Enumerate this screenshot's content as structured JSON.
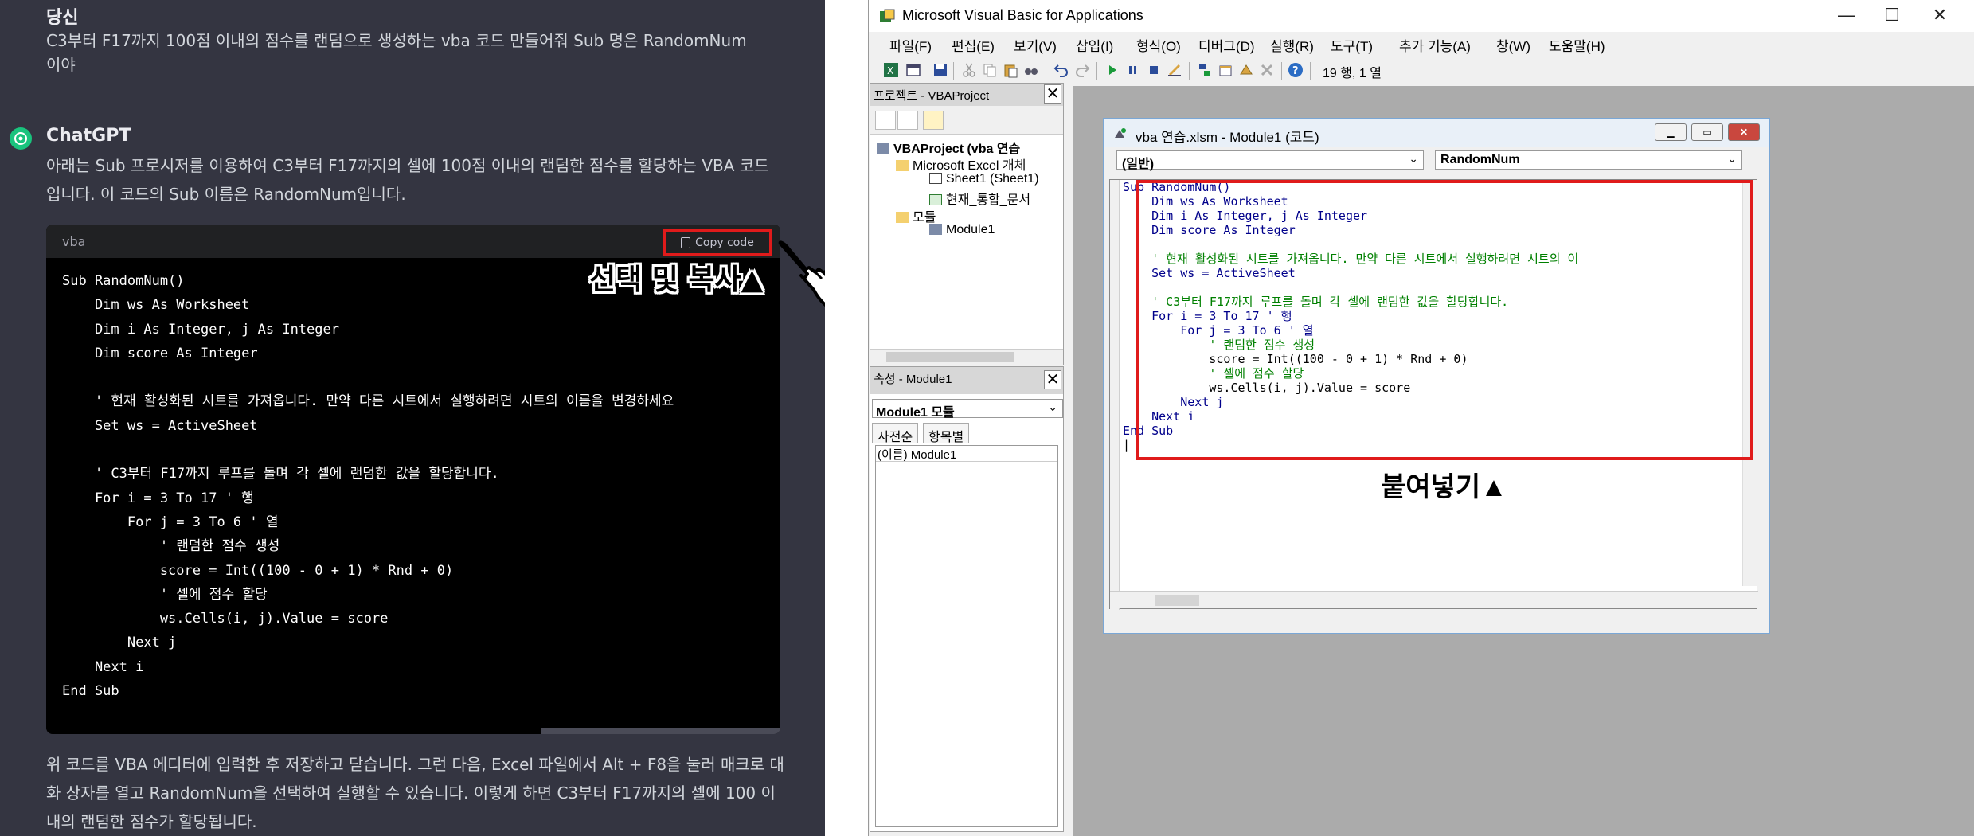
{
  "chat": {
    "user_name": "당신",
    "user_message": "C3부터 F17까지 100점 이내의 점수를 랜덤으로 생성하는 vba 코드 만들어줘 Sub 명은 RandomNum 이야",
    "bot_name": "ChatGPT",
    "bot_message": "아래는 Sub 프로시저를 이용하여 C3부터 F17까지의 셀에 100점 이내의 랜덤한 점수를 할당하는 VBA 코드입니다. 이 코드의 Sub 이름은 RandomNum입니다.",
    "code_lang": "vba",
    "copy_label": "Copy code",
    "code": "Sub RandomNum()\n    Dim ws As Worksheet\n    Dim i As Integer, j As Integer\n    Dim score As Integer\n\n    ' 현재 활성화된 시트를 가져옵니다. 만약 다른 시트에서 실행하려면 시트의 이름을 변경하세요\n    Set ws = ActiveSheet\n\n    ' C3부터 F17까지 루프를 돌며 각 셀에 랜덤한 값을 할당합니다.\n    For i = 3 To 17 ' 행\n        For j = 3 To 6 ' 열\n            ' 랜덤한 점수 생성\n            score = Int((100 - 0 + 1) * Rnd + 0)\n            ' 셀에 점수 할당\n            ws.Cells(i, j).Value = score\n        Next j\n    Next i\nEnd Sub",
    "followup": "위 코드를 VBA 에디터에 입력한 후 저장하고 닫습니다. 그런 다음, Excel 파일에서 Alt + F8을 눌러 매크로 대화 상자를 열고 RandomNum을 선택하여 실행할 수 있습니다. 이렇게 하면 C3부터 F17까지의 셀에 100 이내의 랜덤한 점수가 할당됩니다."
  },
  "annotations": {
    "copy": "선택 및 복사▲",
    "paste": "붙여넣기▲"
  },
  "vba": {
    "title": "Microsoft Visual Basic for Applications",
    "menu": [
      "파일(F)",
      "편집(E)",
      "보기(V)",
      "삽입(I)",
      "형식(O)",
      "디버그(D)",
      "실행(R)",
      "도구(T)",
      "추가 기능(A)",
      "창(W)",
      "도움말(H)"
    ],
    "cursor_pos": "19 행, 1 열",
    "project_title": "프로젝트 - VBAProject",
    "tree": {
      "root": "VBAProject (vba 연습",
      "excel_objects": "Microsoft Excel 개체",
      "sheet1": "Sheet1 (Sheet1)",
      "workbook": "현재_통합_문서",
      "modules": "모듈",
      "module1": "Module1"
    },
    "props_title": "속성 - Module1",
    "props_select": "Module1 모듈",
    "props_tab_alpha": "사전순",
    "props_tab_cat": "항목별",
    "props_row": "(이름) Module1",
    "code_window_title": "vba 연습.xlsm - Module1 (코드)",
    "combo_object": "(일반)",
    "combo_proc": "RandomNum",
    "code_lines": [
      {
        "t": "Sub RandomNum()",
        "c": "kw"
      },
      {
        "t": "    Dim ws As Worksheet",
        "c": "kw"
      },
      {
        "t": "    Dim i As Integer, j As Integer",
        "c": "kw"
      },
      {
        "t": "    Dim score As Integer",
        "c": "kw"
      },
      {
        "t": "",
        "c": ""
      },
      {
        "t": "    ' 현재 활성화된 시트를 가져옵니다. 만약 다른 시트에서 실행하려면 시트의 이",
        "c": "cm"
      },
      {
        "t": "    Set ws = ActiveSheet",
        "c": "kw"
      },
      {
        "t": "",
        "c": ""
      },
      {
        "t": "    ' C3부터 F17까지 루프를 돌며 각 셀에 랜덤한 값을 할당합니다.",
        "c": "cm"
      },
      {
        "t": "    For i = 3 To 17 ' 행",
        "c": "kw"
      },
      {
        "t": "        For j = 3 To 6 ' 열",
        "c": "kw"
      },
      {
        "t": "            ' 랜덤한 점수 생성",
        "c": "cm"
      },
      {
        "t": "            score = Int((100 - 0 + 1) * Rnd + 0)",
        "c": ""
      },
      {
        "t": "            ' 셀에 점수 할당",
        "c": "cm"
      },
      {
        "t": "            ws.Cells(i, j).Value = score",
        "c": ""
      },
      {
        "t": "        Next j",
        "c": "kw"
      },
      {
        "t": "    Next i",
        "c": "kw"
      },
      {
        "t": "End Sub",
        "c": "kw"
      },
      {
        "t": "|",
        "c": ""
      }
    ]
  },
  "colors": {
    "highlight": "#e01b1b",
    "chat_bg": "#343541",
    "code_bg": "#000000"
  }
}
